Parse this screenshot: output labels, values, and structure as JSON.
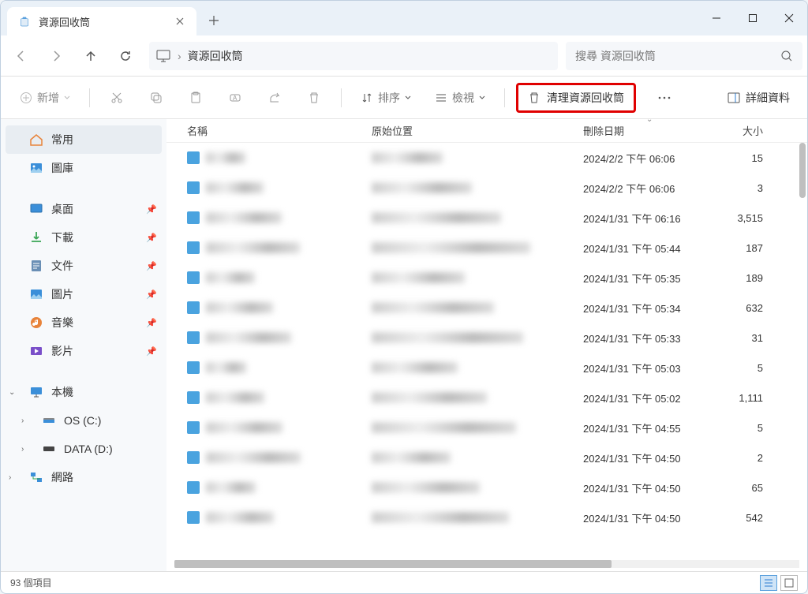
{
  "tab": {
    "title": "資源回收筒"
  },
  "address": {
    "path": "資源回收筒"
  },
  "search": {
    "placeholder": "搜尋 資源回收筒"
  },
  "toolbar": {
    "new_label": "新增",
    "sort_label": "排序",
    "view_label": "檢視",
    "empty_label": "清理資源回收筒",
    "details_label": "詳細資料"
  },
  "sidebar": {
    "home": "常用",
    "gallery": "圖庫",
    "desktop": "桌面",
    "downloads": "下載",
    "documents": "文件",
    "pictures": "圖片",
    "music": "音樂",
    "videos": "影片",
    "thispc": "本機",
    "drive_c": "OS (C:)",
    "drive_d": "DATA (D:)",
    "network": "網路"
  },
  "columns": {
    "name": "名稱",
    "location": "原始位置",
    "deleted": "刪除日期",
    "size": "大小"
  },
  "rows": [
    {
      "date": "2024/2/2 下午 06:06",
      "size": "15"
    },
    {
      "date": "2024/2/2 下午 06:06",
      "size": "3"
    },
    {
      "date": "2024/1/31 下午 06:16",
      "size": "3,515"
    },
    {
      "date": "2024/1/31 下午 05:44",
      "size": "187"
    },
    {
      "date": "2024/1/31 下午 05:35",
      "size": "189"
    },
    {
      "date": "2024/1/31 下午 05:34",
      "size": "632"
    },
    {
      "date": "2024/1/31 下午 05:33",
      "size": "31"
    },
    {
      "date": "2024/1/31 下午 05:03",
      "size": "5"
    },
    {
      "date": "2024/1/31 下午 05:02",
      "size": "1,111"
    },
    {
      "date": "2024/1/31 下午 04:55",
      "size": "5"
    },
    {
      "date": "2024/1/31 下午 04:50",
      "size": "2"
    },
    {
      "date": "2024/1/31 下午 04:50",
      "size": "65"
    },
    {
      "date": "2024/1/31 下午 04:50",
      "size": "542"
    }
  ],
  "status": {
    "count": "93 個項目"
  }
}
